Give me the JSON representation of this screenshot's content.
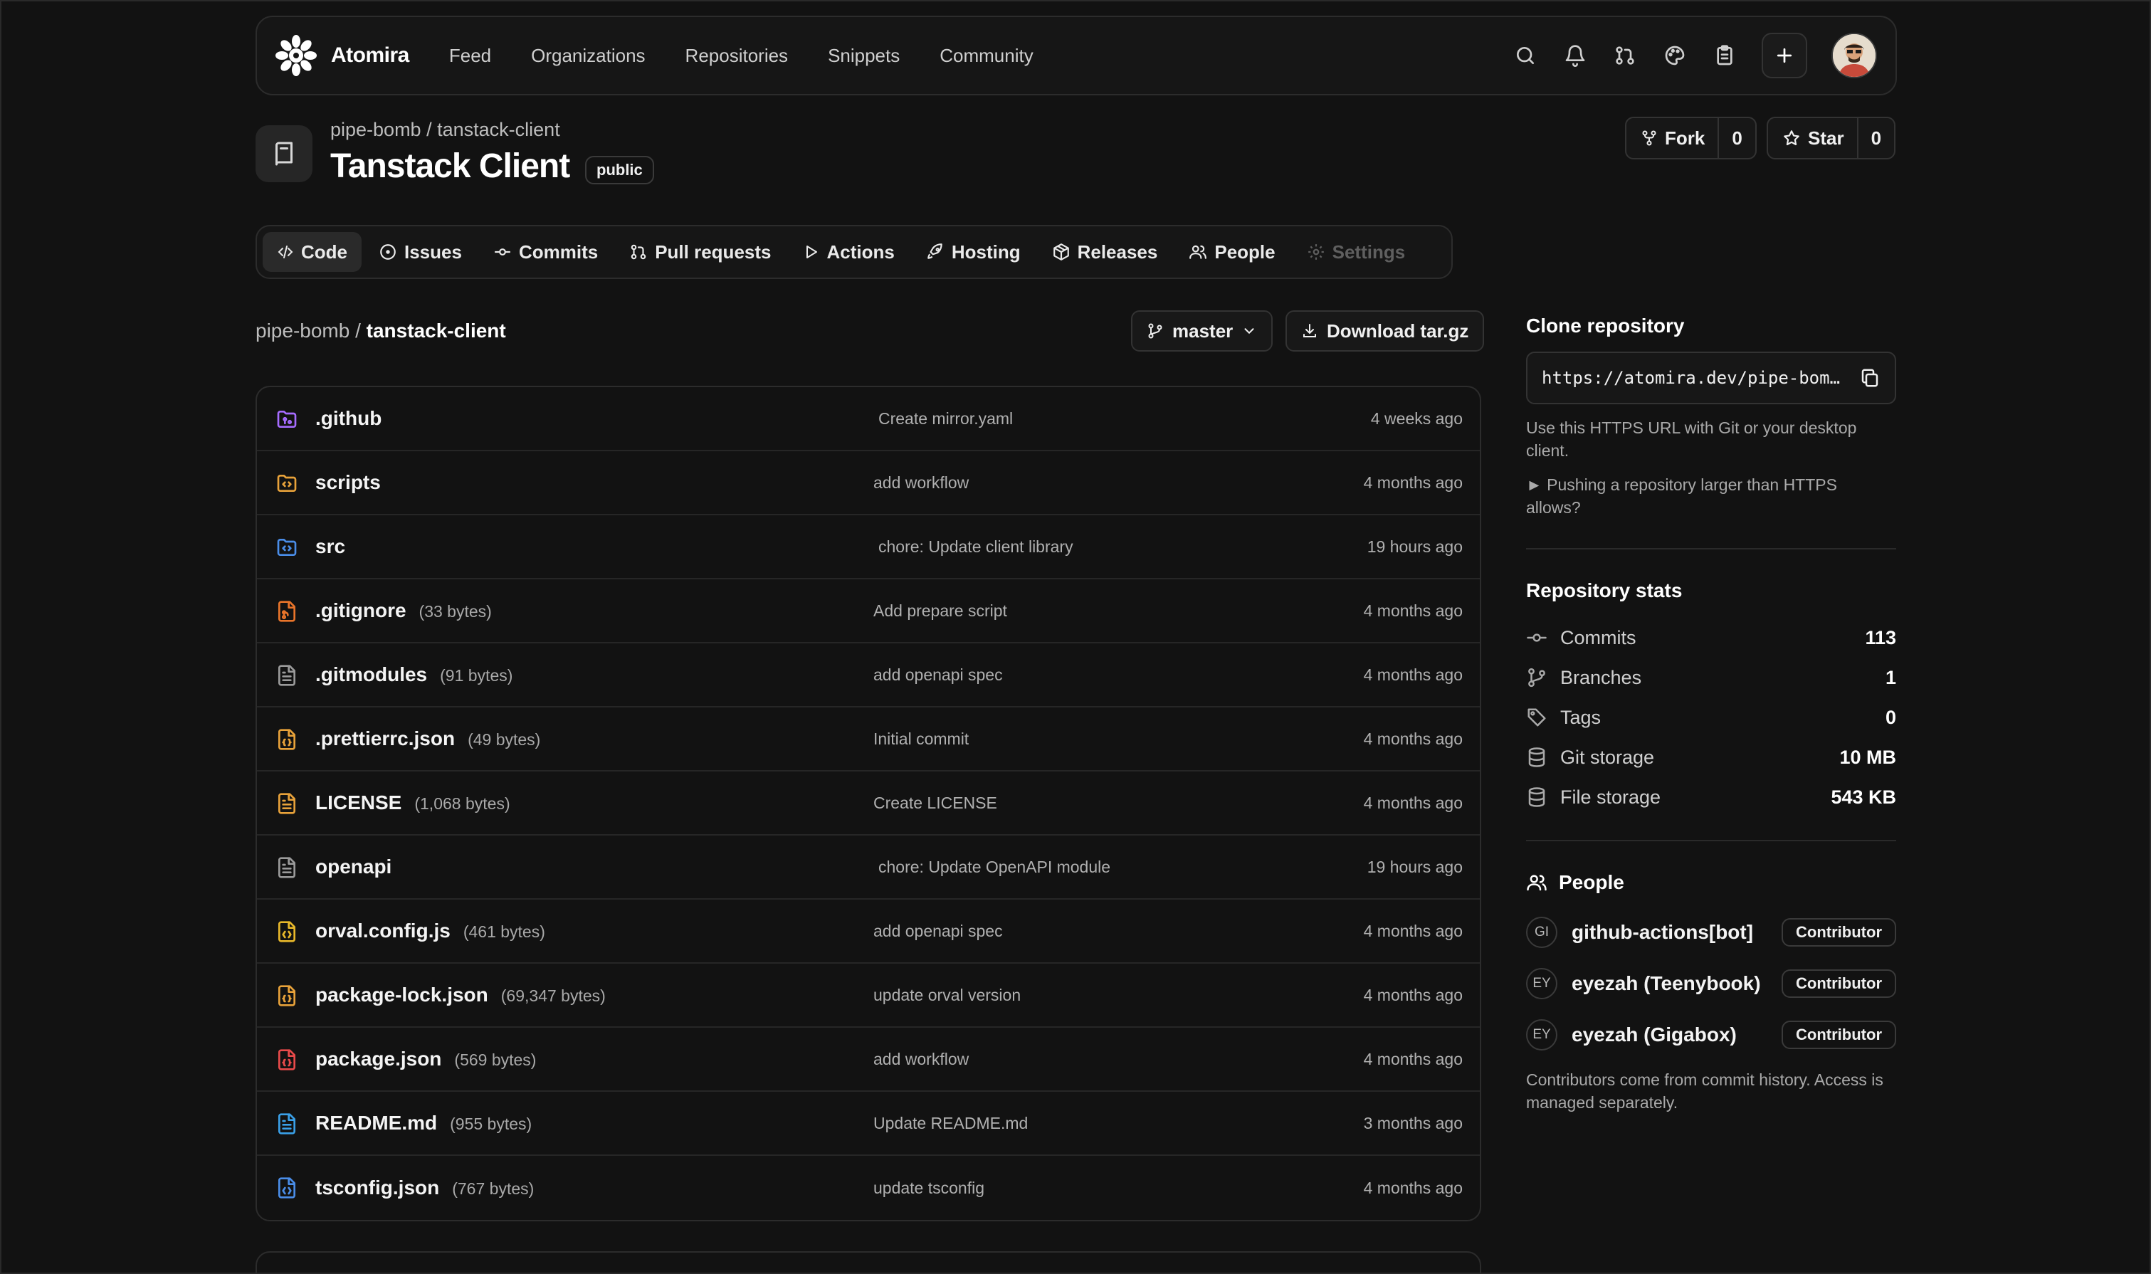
{
  "nav": {
    "brand": "Atomira",
    "links": [
      "Feed",
      "Organizations",
      "Repositories",
      "Snippets",
      "Community"
    ]
  },
  "repo": {
    "owner": "pipe-bomb",
    "sep": "/",
    "name": "tanstack-client",
    "title": "Tanstack Client",
    "visibility": "public",
    "fork_label": "Fork",
    "fork_count": "0",
    "star_label": "Star",
    "star_count": "0"
  },
  "tabs": [
    "Code",
    "Issues",
    "Commits",
    "Pull requests",
    "Actions",
    "Hosting",
    "Releases",
    "People",
    "Settings"
  ],
  "browser": {
    "crumb_owner": "pipe-bomb",
    "crumb_sep": "/",
    "crumb_repo": "tanstack-client",
    "branch": "master",
    "download": "Download tar.gz"
  },
  "files": [
    {
      "name": ".github",
      "size": "",
      "message": "Create mirror.yaml",
      "time": "4 weeks ago",
      "icon": "folder-git-icon",
      "color": "#a66cff"
    },
    {
      "name": "scripts",
      "size": "",
      "message": "add workflow",
      "time": "4 months ago",
      "icon": "folder-code-icon",
      "color": "#e8a23a"
    },
    {
      "name": "src",
      "size": "",
      "message": "chore: Update client library",
      "time": "19 hours ago",
      "icon": "folder-code-icon",
      "color": "#4a8de8"
    },
    {
      "name": ".gitignore",
      "size": "(33 bytes)",
      "message": "Add prepare script",
      "time": "4 months ago",
      "icon": "file-git-icon",
      "color": "#e8742a"
    },
    {
      "name": ".gitmodules",
      "size": "(91 bytes)",
      "message": "add openapi spec",
      "time": "4 months ago",
      "icon": "file-text-icon",
      "color": "#9a9a9a"
    },
    {
      "name": ".prettierrc.json",
      "size": "(49 bytes)",
      "message": "Initial commit",
      "time": "4 months ago",
      "icon": "file-json-icon",
      "color": "#e8a23a"
    },
    {
      "name": "LICENSE",
      "size": "(1,068 bytes)",
      "message": "Create LICENSE",
      "time": "4 months ago",
      "icon": "file-text-icon",
      "color": "#e8a23a"
    },
    {
      "name": "openapi",
      "size": "",
      "message": "chore: Update OpenAPI module",
      "time": "19 hours ago",
      "icon": "file-text-icon",
      "color": "#9a9a9a"
    },
    {
      "name": "orval.config.js",
      "size": "(461 bytes)",
      "message": "add openapi spec",
      "time": "4 months ago",
      "icon": "file-code-icon",
      "color": "#e8b82a"
    },
    {
      "name": "package-lock.json",
      "size": "(69,347 bytes)",
      "message": "update orval version",
      "time": "4 months ago",
      "icon": "file-json-icon",
      "color": "#e8a23a"
    },
    {
      "name": "package.json",
      "size": "(569 bytes)",
      "message": "add workflow",
      "time": "4 months ago",
      "icon": "file-json-icon",
      "color": "#e84a4a"
    },
    {
      "name": "README.md",
      "size": "(955 bytes)",
      "message": "Update README.md",
      "time": "3 months ago",
      "icon": "file-text-icon",
      "color": "#3aa0e8"
    },
    {
      "name": "tsconfig.json",
      "size": "(767 bytes)",
      "message": "update tsconfig",
      "time": "4 months ago",
      "icon": "file-code-icon",
      "color": "#4a8de8"
    }
  ],
  "sidebar": {
    "clone_title": "Clone repository",
    "clone_url": "https://atomira.dev/pipe-bomb/tanstack-client",
    "clone_help": "Use this HTTPS URL with Git or your desktop client.",
    "clone_large": "► Pushing a repository larger than HTTPS allows?",
    "stats_title": "Repository stats",
    "stats": [
      {
        "label": "Commits",
        "value": "113",
        "icon": "commit-icon"
      },
      {
        "label": "Branches",
        "value": "1",
        "icon": "branch-icon"
      },
      {
        "label": "Tags",
        "value": "0",
        "icon": "tag-icon"
      },
      {
        "label": "Git storage",
        "value": "10 MB",
        "icon": "database-icon"
      },
      {
        "label": "File storage",
        "value": "543 KB",
        "icon": "database-icon"
      }
    ],
    "people_title": "People",
    "people": [
      {
        "initials": "GI",
        "name": "github-actions[bot]",
        "role": "Contributor"
      },
      {
        "initials": "EY",
        "name": "eyezah (Teenybook)",
        "role": "Contributor"
      },
      {
        "initials": "EY",
        "name": "eyezah (Gigabox)",
        "role": "Contributor"
      }
    ],
    "people_note": "Contributors come from commit history. Access is managed separately."
  }
}
